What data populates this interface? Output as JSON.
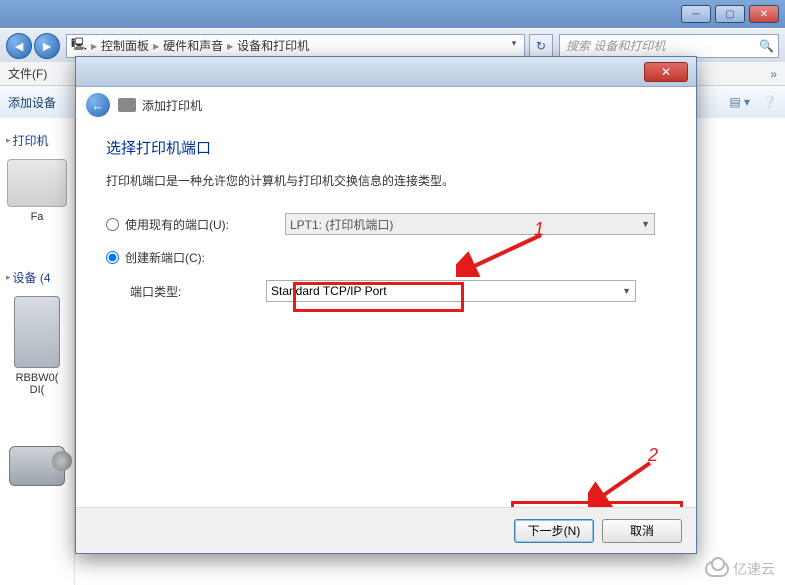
{
  "explorer": {
    "breadcrumb": {
      "root_icon": "control-panel",
      "seg1": "控制面板",
      "seg2": "硬件和声音",
      "seg3": "设备和打印机"
    },
    "search_placeholder": "搜索 设备和打印机",
    "menu": {
      "file": "文件(F)"
    },
    "toolbar": {
      "add_device": "添加设备",
      "help": "帮助"
    },
    "sidebar": {
      "section_printers": "打印机",
      "fax_label": "Fa",
      "section_devices": "设备 (4",
      "device_label_1": "RBBW0(",
      "device_label_2": "DI("
    }
  },
  "dialog": {
    "header": "添加打印机",
    "title": "选择打印机端口",
    "description": "打印机端口是一种允许您的计算机与打印机交换信息的连接类型。",
    "radio_existing": "使用现有的端口(U):",
    "existing_value": "LPT1: (打印机端口)",
    "radio_create": "创建新端口(C):",
    "port_type_label": "端口类型:",
    "port_type_value": "Standard TCP/IP Port",
    "btn_next": "下一步(N)",
    "btn_cancel": "取消",
    "annotation_1": "1",
    "annotation_2": "2"
  },
  "watermark": "亿速云"
}
